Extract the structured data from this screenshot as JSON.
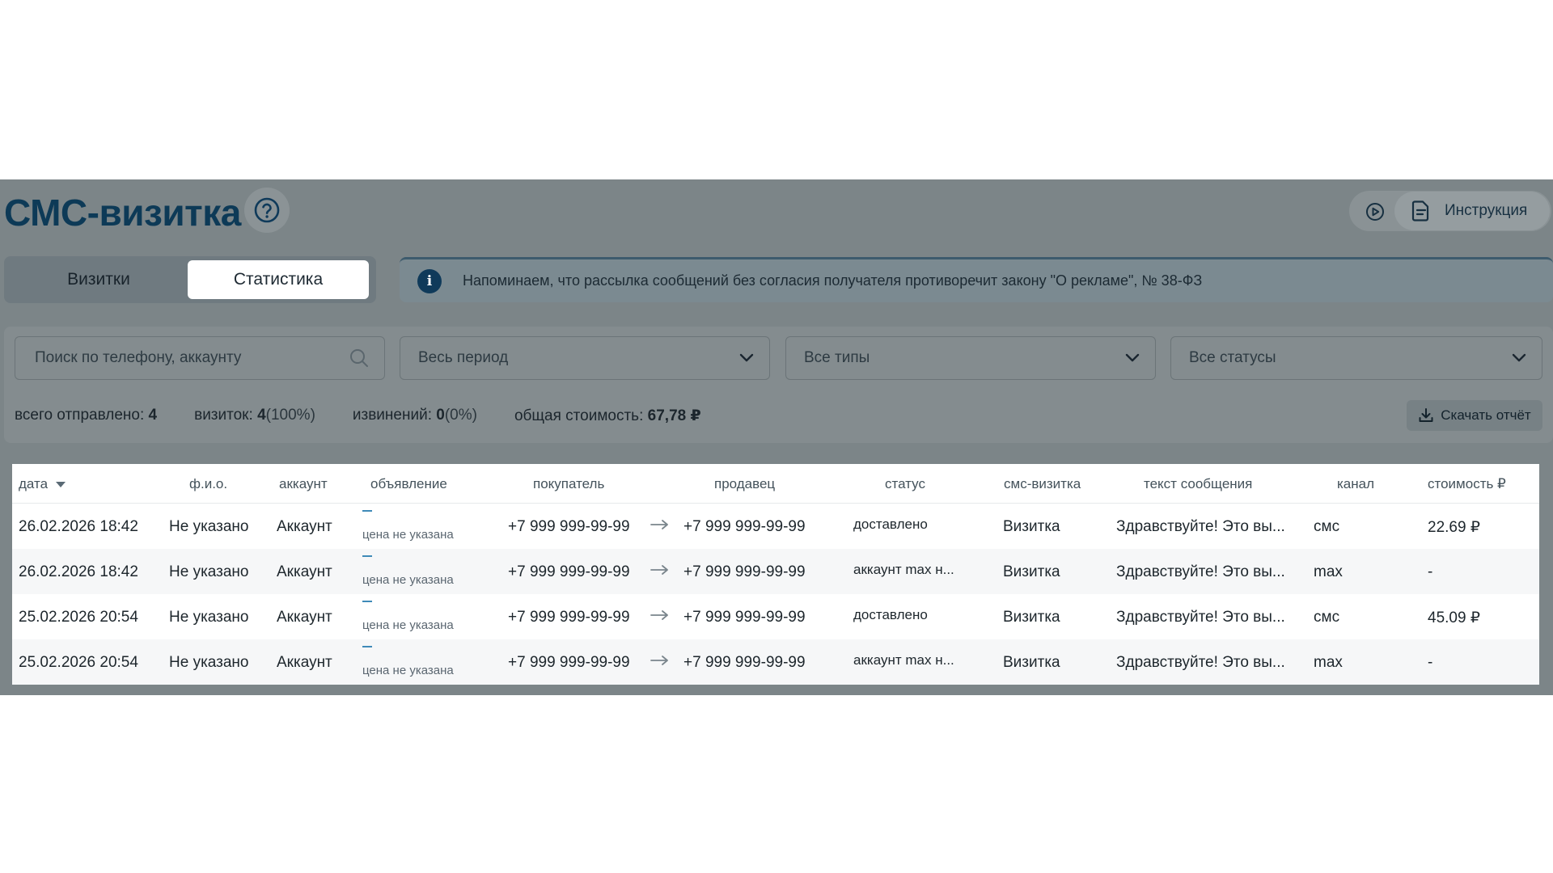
{
  "header": {
    "title": "СМС-визитка",
    "instruction_label": "Инструкция"
  },
  "tabs": [
    {
      "label": "Визитки",
      "active": false
    },
    {
      "label": "Статистика",
      "active": true
    }
  ],
  "notice": {
    "icon": "info-icon",
    "text": "Напоминаем, что рассылка сообщений без согласия получателя противоречит закону \"О рекламе\", № 38-ФЗ"
  },
  "filters": {
    "search_placeholder": "Поиск по телефону, аккаунту",
    "period": "Весь период",
    "types": "Все типы",
    "statuses": "Все статусы"
  },
  "stats": {
    "sent_label": "всего отправлено:",
    "sent_value": "4",
    "cards_label": "визиток:",
    "cards_value": "4",
    "cards_pct": "(100%)",
    "apologies_label": "извинений:",
    "apologies_value": "0",
    "apologies_pct": "(0%)",
    "cost_label": "общая стоимость:",
    "cost_value": "67,78 ₽",
    "download_label": "Скачать отчёт"
  },
  "table": {
    "columns": [
      "дата",
      "ф.и.о.",
      "аккаунт",
      "объявление",
      "покупатель",
      "продавец",
      "статус",
      "смс-визитка",
      "текст сообщения",
      "канал",
      "стоимость ₽"
    ],
    "rows": [
      {
        "date": "26.02.2026 18:42",
        "name": "Не указано",
        "account": "Аккаунт",
        "ad_title": "—",
        "ad_price": "цена не указана",
        "buyer": "+7 999 999-99-99",
        "seller": "+7 999 999-99-99",
        "status": "доставлено",
        "card": "Визитка",
        "text": "Здравствуйте! Это вы...",
        "channel": "смс",
        "cost": "22.69 ₽"
      },
      {
        "date": "26.02.2026 18:42",
        "name": "Не указано",
        "account": "Аккаунт",
        "ad_title": "—",
        "ad_price": "цена не указана",
        "buyer": "+7 999 999-99-99",
        "seller": "+7 999 999-99-99",
        "status": "аккаунт max н...",
        "card": "Визитка",
        "text": "Здравствуйте! Это вы...",
        "channel": "max",
        "cost": "-"
      },
      {
        "date": "25.02.2026 20:54",
        "name": "Не указано",
        "account": "Аккаунт",
        "ad_title": "—",
        "ad_price": "цена не указана",
        "buyer": "+7 999 999-99-99",
        "seller": "+7 999 999-99-99",
        "status": "доставлено",
        "card": "Визитка",
        "text": "Здравствуйте! Это вы...",
        "channel": "смс",
        "cost": "45.09 ₽"
      },
      {
        "date": "25.02.2026 20:54",
        "name": "Не указано",
        "account": "Аккаунт",
        "ad_title": "—",
        "ad_price": "цена не указана",
        "buyer": "+7 999 999-99-99",
        "seller": "+7 999 999-99-99",
        "status": "аккаунт max н...",
        "card": "Визитка",
        "text": "Здравствуйте! Это вы...",
        "channel": "max",
        "cost": "-"
      }
    ]
  },
  "colors": {
    "title": "#0d3a57",
    "overlay": "#7c8588",
    "accent": "#3f8ab8"
  }
}
